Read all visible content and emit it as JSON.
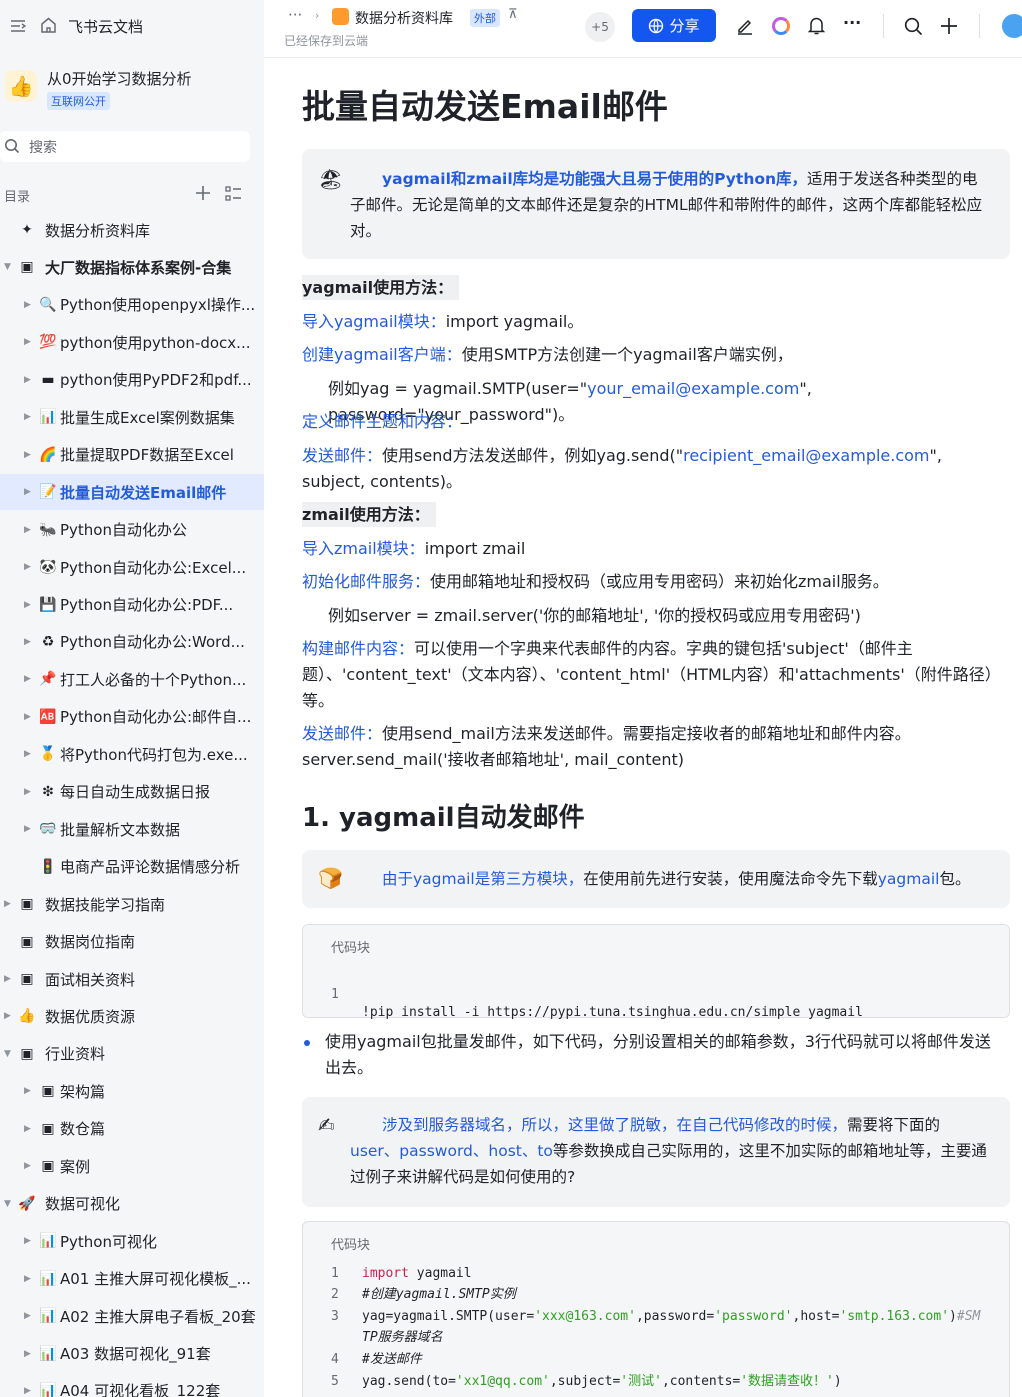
{
  "app": {
    "title": "飞书云文档"
  },
  "workspace": {
    "name": "从0开始学习数据分析",
    "badge": "互联网公开"
  },
  "search": {
    "placeholder": "搜索"
  },
  "toc": {
    "label": "目录"
  },
  "tree": [
    {
      "label": "数据分析资料库",
      "icon": "✦",
      "level": 0,
      "arrow": false
    },
    {
      "label": "大厂数据指标体系案例-合集",
      "icon": "▣",
      "level": 0,
      "arrow": "down",
      "bold": true
    },
    {
      "label": "Python使用openpyxl操作...",
      "icon": "🔍",
      "level": 1,
      "arrow": "right"
    },
    {
      "label": "python使用python-docx...",
      "icon": "💯",
      "level": 1,
      "arrow": "right"
    },
    {
      "label": "python使用PyPDF2和pdf...",
      "icon": "▬",
      "level": 1,
      "arrow": "right"
    },
    {
      "label": "批量生成Excel案例数据集",
      "icon": "📊",
      "level": 1,
      "arrow": "right"
    },
    {
      "label": "批量提取PDF数据至Excel",
      "icon": "🌈",
      "level": 1,
      "arrow": "right"
    },
    {
      "label": "批量自动发送Email邮件",
      "icon": "📝",
      "level": 1,
      "arrow": "right",
      "active": true
    },
    {
      "label": "Python自动化办公",
      "icon": "🐜",
      "level": 1,
      "arrow": "right"
    },
    {
      "label": "Python自动化办公:Excel...",
      "icon": "🐼",
      "level": 1,
      "arrow": "right"
    },
    {
      "label": "Python自动化办公:PDF...",
      "icon": "💾",
      "level": 1,
      "arrow": "right"
    },
    {
      "label": "Python自动化办公:Word...",
      "icon": "♻",
      "level": 1,
      "arrow": "right"
    },
    {
      "label": "打工人必备的十个Python...",
      "icon": "📌",
      "level": 1,
      "arrow": "right"
    },
    {
      "label": "Python自动化办公:邮件自...",
      "icon": "🆎",
      "level": 1,
      "arrow": "right"
    },
    {
      "label": "将Python代码打包为.exe...",
      "icon": "🥇",
      "level": 1,
      "arrow": "right"
    },
    {
      "label": "每日自动生成数据日报",
      "icon": "❇",
      "level": 1,
      "arrow": "right"
    },
    {
      "label": "批量解析文本数据",
      "icon": "🥽",
      "level": 1,
      "arrow": "right"
    },
    {
      "label": "电商产品评论数据情感分析",
      "icon": "🚦",
      "level": 1,
      "arrow": false
    },
    {
      "label": "数据技能学习指南",
      "icon": "▣",
      "level": 0,
      "arrow": "right"
    },
    {
      "label": "数据岗位指南",
      "icon": "▣",
      "level": 0,
      "arrow": false
    },
    {
      "label": "面试相关资料",
      "icon": "▣",
      "level": 0,
      "arrow": "right"
    },
    {
      "label": "数据优质资源",
      "icon": "👍",
      "level": 0,
      "arrow": "right"
    },
    {
      "label": "行业资料",
      "icon": "▣",
      "level": 0,
      "arrow": "down"
    },
    {
      "label": "架构篇",
      "icon": "▣",
      "level": 1,
      "arrow": "right"
    },
    {
      "label": "数仓篇",
      "icon": "▣",
      "level": 1,
      "arrow": "right"
    },
    {
      "label": "案例",
      "icon": "▣",
      "level": 1,
      "arrow": "right"
    },
    {
      "label": "数据可视化",
      "icon": "🚀",
      "level": 0,
      "arrow": "down"
    },
    {
      "label": "Python可视化",
      "icon": "📊",
      "level": 1,
      "arrow": "right"
    },
    {
      "label": "A01 主推大屏可视化模板_...",
      "icon": "📊",
      "level": 1,
      "arrow": "right"
    },
    {
      "label": "A02 主推大屏电子看板_20套",
      "icon": "📊",
      "level": 1,
      "arrow": "right"
    },
    {
      "label": "A03 数据可视化_91套",
      "icon": "📊",
      "level": 1,
      "arrow": "right"
    },
    {
      "label": "A04 可视化看板_122套",
      "icon": "📊",
      "level": 1,
      "arrow": "right"
    }
  ],
  "header": {
    "breadcrumb_dots": "···",
    "doc_name": "数据分析资料库",
    "ext_tag": "外部",
    "saved": "已经保存到云端",
    "collab_count": "+5",
    "share_label": "分享"
  },
  "doc": {
    "title": "批量自动发送Email邮件",
    "callout1": {
      "emoji": "🏖",
      "lead": "yagmail和zmail库均是功能强大且易于使用的Python库，",
      "rest": "适用于发送各种类型的电子邮件。无论是简单的文本邮件还是复杂的HTML邮件和带附件的邮件，这两个库都能轻松应对。"
    },
    "y_heading": "yagmail使用方法：",
    "y1": {
      "a": "导入yagmail模块：",
      "b": "import yagmail。"
    },
    "y2": {
      "a": "创建yagmail客户端：",
      "b": "使用SMTP方法创建一个yagmail客户端实例，"
    },
    "y2ex": {
      "a": "例如yag = yagmail.SMTP(user=\"",
      "link": "your_email@example.com",
      "b": "\", password=\"your_password\")。"
    },
    "y3": {
      "a": "定义邮件主题和内容："
    },
    "y4": {
      "a": "发送邮件：",
      "b": "使用send方法发送邮件，例如yag.send(\"",
      "link": "recipient_email@example.com",
      "c": "\", subject, contents)。"
    },
    "z_heading": "zmail使用方法：",
    "z1": {
      "a": "导入zmail模块：",
      "b": "import zmail"
    },
    "z2": {
      "a": "初始化邮件服务：",
      "b": "使用邮箱地址和授权码（或应用专用密码）来初始化zmail服务。"
    },
    "z2ex": "例如server = zmail.server('你的邮箱地址', '你的授权码或应用专用密码')",
    "z3": {
      "a": "构建邮件内容：",
      "b": "可以使用一个字典来代表邮件的内容。字典的键包括'subject'（邮件主题）、'content_text'（文本内容）、'content_html'（HTML内容）和'attachments'（附件路径）等。"
    },
    "z4": {
      "a": "发送邮件：",
      "b": "使用send_mail方法来发送邮件。需要指定接收者的邮箱地址和邮件内容。server.send_mail('接收者邮箱地址', mail_content)"
    },
    "h1": "1. yagmail自动发邮件",
    "callout2": {
      "emoji": "🍞",
      "a": "由于yagmail是第三方模块，",
      "b": "在使用前先进行安装，使用魔法命令先下载",
      "c": "yagmail",
      "d": "包。"
    },
    "code1": {
      "caption": "代码块",
      "lines": [
        {
          "n": "1",
          "code": "!pip install -i https://pypi.tuna.tsinghua.edu.cn/simple yagmail"
        }
      ]
    },
    "bullet1": "使用yagmail包批量发邮件，如下代码，分别设置相关的邮箱参数，3行代码就可以将邮件发送出去。",
    "callout3": {
      "emoji": "✍",
      "a": "涉及到服务器域名，所以，这里做了脱敏，在自己代码修改的时候，",
      "b": "需要将下面的",
      "c": "user、password、host、to",
      "d": "等参数换成自己实际用的，这里不加实际的邮箱地址等，主要通过例子来讲解代码是如何使用的?"
    },
    "code2": {
      "caption": "代码块",
      "l1n": "1",
      "l1kw": "import",
      "l1rest": " yagmail",
      "l2n": "2",
      "l2": "#创建yagmail.SMTP实例",
      "l3n": "3",
      "l3a": "yag=yagmail.SMTP(user=",
      "l3s1": "'xxx@163.com'",
      "l3b": ",password=",
      "l3s2": "'password'",
      "l3c": ",host=",
      "l3s3": "'smtp.163.com'",
      "l3d": ")",
      "l3cm": "#SM",
      "l3cm2": "TP服务器域名",
      "l4n": "4",
      "l4": "#发送邮件",
      "l5n": "5",
      "l5a": "yag.send(to=",
      "l5s1": "'xx1@qq.com'",
      "l5b": ",subject=",
      "l5s2": "'测试'",
      "l5c": ",contents=",
      "l5s3": "'数据请查收！'",
      "l5d": ")"
    }
  }
}
